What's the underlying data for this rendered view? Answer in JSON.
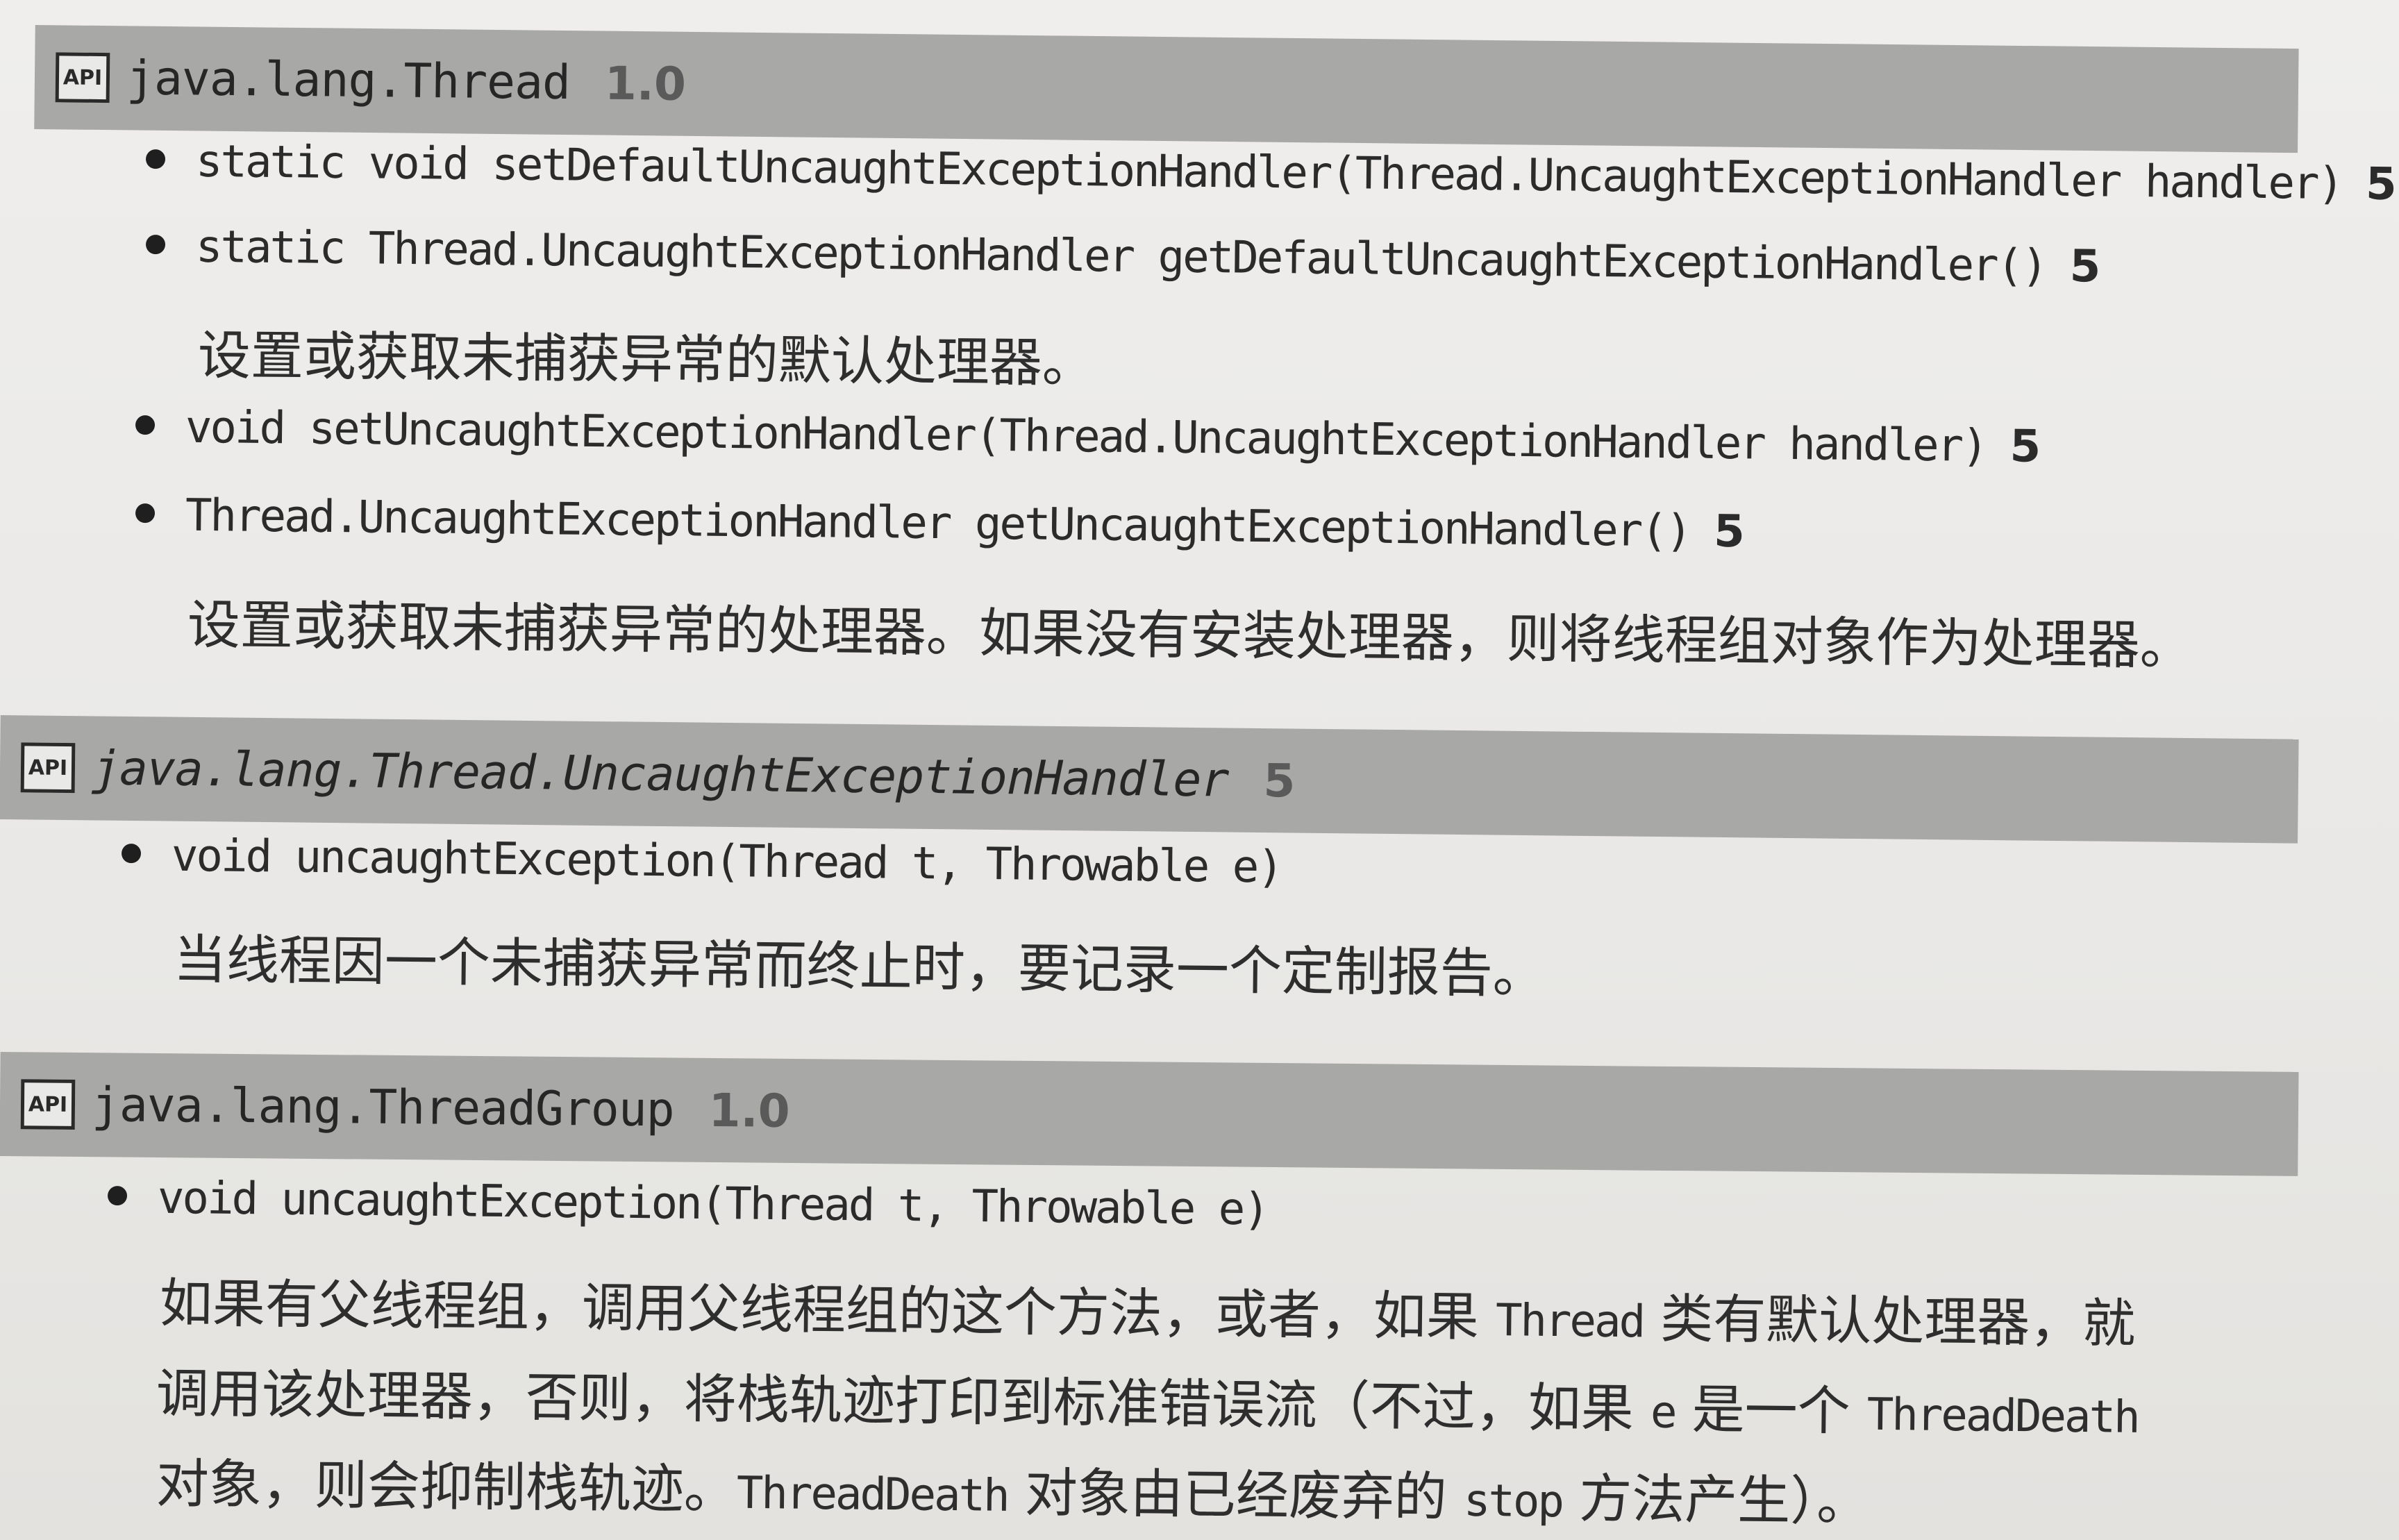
{
  "sections": [
    {
      "badge": "API",
      "title": "java.lang.Thread",
      "version": "1.0",
      "items": [
        {
          "signature": "static void setDefaultUncaughtExceptionHandler(Thread.UncaughtExceptionHandler handler)",
          "since": "5"
        },
        {
          "signature": "static Thread.UncaughtExceptionHandler getDefaultUncaughtExceptionHandler()",
          "since": "5"
        },
        {
          "description": "设置或获取未捕获异常的默认处理器。"
        },
        {
          "signature": "void setUncaughtExceptionHandler(Thread.UncaughtExceptionHandler handler)",
          "since": "5"
        },
        {
          "signature": "Thread.UncaughtExceptionHandler getUncaughtExceptionHandler()",
          "since": "5"
        },
        {
          "description": "设置或获取未捕获异常的处理器。如果没有安装处理器，则将线程组对象作为处理器。"
        }
      ]
    },
    {
      "badge": "API",
      "title": "java.lang.Thread.UncaughtExceptionHandler",
      "version": "5",
      "items": [
        {
          "signature": "void uncaughtException(Thread t, Throwable e)"
        },
        {
          "description": "当线程因一个未捕获异常而终止时，要记录一个定制报告。"
        }
      ]
    },
    {
      "badge": "API",
      "title": "java.lang.ThreadGroup",
      "version": "1.0",
      "items": [
        {
          "signature": "void uncaughtException(Thread t, Throwable e)"
        },
        {
          "description_parts": [
            {
              "a": "如果有父线程组，调用父线程组的这个方法，或者，如果 ",
              "code": "Thread",
              "b": " 类有默认处理器，就"
            },
            {
              "a": "调用该处理器，否则，将栈轨迹打印到标准错误流（不过，如果 ",
              "code": "e",
              "b": " 是一个 ",
              "code2": "ThreadDeath"
            },
            {
              "a": "对象，则会抑制栈轨迹。",
              "code": "ThreadDeath",
              "b": " 对象由已经废弃的 ",
              "code2": "stop",
              "c": " 方法产生）。"
            }
          ]
        }
      ]
    }
  ]
}
